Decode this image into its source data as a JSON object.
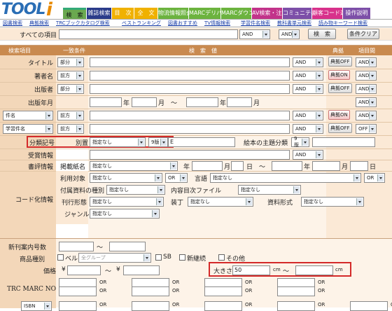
{
  "logo": {
    "text": "TOOL",
    "accent": "i"
  },
  "nav_tabs": [
    {
      "label": "検　索",
      "color": "#1a1a1a",
      "text": "#ffffff"
    },
    {
      "label": "雑誌検索",
      "color": "#2b3c8a",
      "text": "#ffffff"
    },
    {
      "label": "目　次",
      "color": "#f0b100",
      "text": "#ffffff"
    },
    {
      "label": "全　文",
      "color": "#f0b100",
      "text": "#ffffff"
    },
    {
      "label": "物流情報照会",
      "color": "#6cb33f",
      "text": "#ffffff"
    },
    {
      "label": "MARCデリバリ",
      "color": "#6cb33f",
      "text": "#ffffff"
    },
    {
      "label": "MARCダウンロード",
      "color": "#6cb33f",
      "text": "#ffffff"
    },
    {
      "label": "AV検索・注文",
      "color": "#c2338a",
      "text": "#ffffff"
    },
    {
      "label": "コミュニティ",
      "color": "#7d4fa8",
      "text": "#ffffff"
    },
    {
      "label": "顧客コード選択",
      "color": "#d8318b",
      "text": "#ffffff"
    },
    {
      "label": "操作説明",
      "color": "#7d4fa8",
      "text": "#ffffff"
    }
  ],
  "sub_links": [
    "図書検索",
    "典拠検索",
    "TRCブックカタログ検索",
    "ベストランキング",
    "図書おすすめ",
    "TV情報検索",
    "学習件名検索",
    "教科書単元検索",
    "読み物キーワード検索"
  ],
  "all_items": {
    "label": "すべての項目",
    "op1": "AND",
    "op2": "AND",
    "search_btn": "検　索",
    "clear_btn": "条件クリア"
  },
  "headers": {
    "item": "検索項目",
    "cond": "一致条件",
    "value": "検　索　値",
    "authority": "典拠",
    "item_rel": "項目間"
  },
  "rows": {
    "title": {
      "label": "タイトル",
      "cond": "部分",
      "op": "AND",
      "auth": "典拠OFF",
      "rel": "AND"
    },
    "author": {
      "label": "著者名",
      "cond": "前方",
      "op": "AND",
      "auth": "典拠ON",
      "rel": "AND"
    },
    "publisher": {
      "label": "出版者",
      "cond": "部分",
      "op": "AND",
      "auth": "典拠OFF",
      "rel": "AND"
    },
    "pubdate": {
      "label": "出版年月",
      "y1": "年",
      "m1": "月",
      "tilde": "〜",
      "y2": "年",
      "m2": "月",
      "rel": "AND"
    },
    "subject": {
      "select": "件名",
      "cond": "前方",
      "op": "AND",
      "auth": "典拠ON",
      "rel": "AND"
    },
    "learning": {
      "select": "学習件名",
      "cond": "前方",
      "op": "AND",
      "auth": "典拠OFF",
      "rel": "OFF"
    }
  },
  "classification": {
    "label": "分類記号",
    "sub": "別置",
    "sel1": "指定なし",
    "sel2": "9版",
    "value": "E",
    "picture_label": "絵本の主題分類",
    "picture_sel": "9版"
  },
  "award": {
    "label": "受賞情報",
    "op": "AND"
  },
  "review": {
    "label": "書評情報",
    "media": "掲載紙名",
    "sel": "指定なし",
    "year": "年",
    "month": "月",
    "day": "日",
    "tilde": "〜",
    "year2": "年",
    "month2": "月",
    "day2": "日"
  },
  "code": {
    "label": "コード化情報",
    "target": "利用対象",
    "target_sel": "指定なし",
    "or1": "OR",
    "lang": "言語",
    "lang_sel": "指定なし",
    "or2": "OR",
    "attach": "付属資料の種別",
    "attach_sel": "指定なし",
    "contents": "内容目次ファイル",
    "contents_sel": "指定なし",
    "form": "刊行形態",
    "form_sel": "指定なし",
    "binding": "装丁",
    "binding_sel": "指定なし",
    "material": "資料形式",
    "material_sel": "指定なし",
    "genre": "ジャンル",
    "genre_sel": "指定なし"
  },
  "bottom": {
    "new_number": "新刊案内号数",
    "tilde": "〜",
    "category": "商品種別",
    "bell": "ベル",
    "grp": "全グループ",
    "sb": "SB",
    "cont": "新継続",
    "other": "その他",
    "price": "価格",
    "yen1": "¥",
    "yen2": "¥",
    "size": "大きさ",
    "size_val": "50",
    "cm1": "cm",
    "cm2": "cm",
    "trc": "TRC MARC NO",
    "or": "OR",
    "isbn": "ISBN"
  }
}
